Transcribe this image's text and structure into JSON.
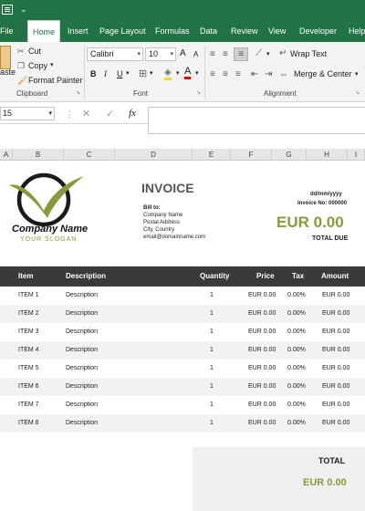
{
  "window": {
    "quick_access": "⌄"
  },
  "tabs": [
    "File",
    "Home",
    "Insert",
    "Page Layout",
    "Formulas",
    "Data",
    "Review",
    "View",
    "Developer",
    "Help"
  ],
  "ribbon": {
    "clipboard": {
      "paste": "aste",
      "cut": "Cut",
      "copy": "Copy",
      "format_painter": "Format Painter",
      "label": "Clipboard"
    },
    "font": {
      "name": "Calibri",
      "size": "10",
      "grow": "A",
      "shrink": "A",
      "bold": "B",
      "italic": "I",
      "underline": "U",
      "label": "Font"
    },
    "alignment": {
      "wrap": "Wrap Text",
      "merge": "Merge & Center",
      "label": "Alignment"
    }
  },
  "formula_bar": {
    "name_box": "15",
    "fx": "fx"
  },
  "columns": [
    "A",
    "B",
    "C",
    "D",
    "E",
    "F",
    "G",
    "H",
    "I"
  ],
  "invoice": {
    "title": "INVOICE",
    "company": "Company Name",
    "slogan": "YOUR SLOGAN",
    "bill_to_label": "Bill to:",
    "bill_to": [
      "Company Name",
      "Postal Address",
      "City, Country",
      "email@domainname.com"
    ],
    "date": "dd/mm/yyyy",
    "invoice_no": "Invoice No: 000000",
    "total_amount": "EUR 0.00",
    "total_due_label": "TOTAL DUE",
    "headers": {
      "item": "Item",
      "description": "Description",
      "quantity": "Quantity",
      "price": "Price",
      "tax": "Tax",
      "amount": "Amount"
    },
    "rows": [
      {
        "item": "ITEM 1",
        "description": "Description",
        "quantity": "1",
        "price": "EUR 0.00",
        "tax": "0.00%",
        "amount": "EUR 0.00"
      },
      {
        "item": "ITEM 2",
        "description": "Description",
        "quantity": "1",
        "price": "EUR 0.00",
        "tax": "0.00%",
        "amount": "EUR 0.00"
      },
      {
        "item": "ITEM 3",
        "description": "Description",
        "quantity": "1",
        "price": "EUR 0.00",
        "tax": "0.00%",
        "amount": "EUR 0.00"
      },
      {
        "item": "ITEM 4",
        "description": "Description",
        "quantity": "1",
        "price": "EUR 0.00",
        "tax": "0.00%",
        "amount": "EUR 0.00"
      },
      {
        "item": "ITEM 5",
        "description": "Description",
        "quantity": "1",
        "price": "EUR 0.00",
        "tax": "0.00%",
        "amount": "EUR 0.00"
      },
      {
        "item": "ITEM 6",
        "description": "Description",
        "quantity": "1",
        "price": "EUR 0.00",
        "tax": "0.00%",
        "amount": "EUR 0.00"
      },
      {
        "item": "ITEM 7",
        "description": "Description",
        "quantity": "1",
        "price": "EUR 0.00",
        "tax": "0.00%",
        "amount": "EUR 0.00"
      },
      {
        "item": "ITEM 8",
        "description": "Description",
        "quantity": "1",
        "price": "EUR 0.00",
        "tax": "0.00%",
        "amount": "EUR 0.00"
      }
    ],
    "total_label": "TOTAL",
    "total_value": "EUR 0.00"
  },
  "colors": {
    "excel_green": "#217346",
    "accent_olive": "#8a9a3a",
    "header_dark": "#3a3a3a"
  }
}
